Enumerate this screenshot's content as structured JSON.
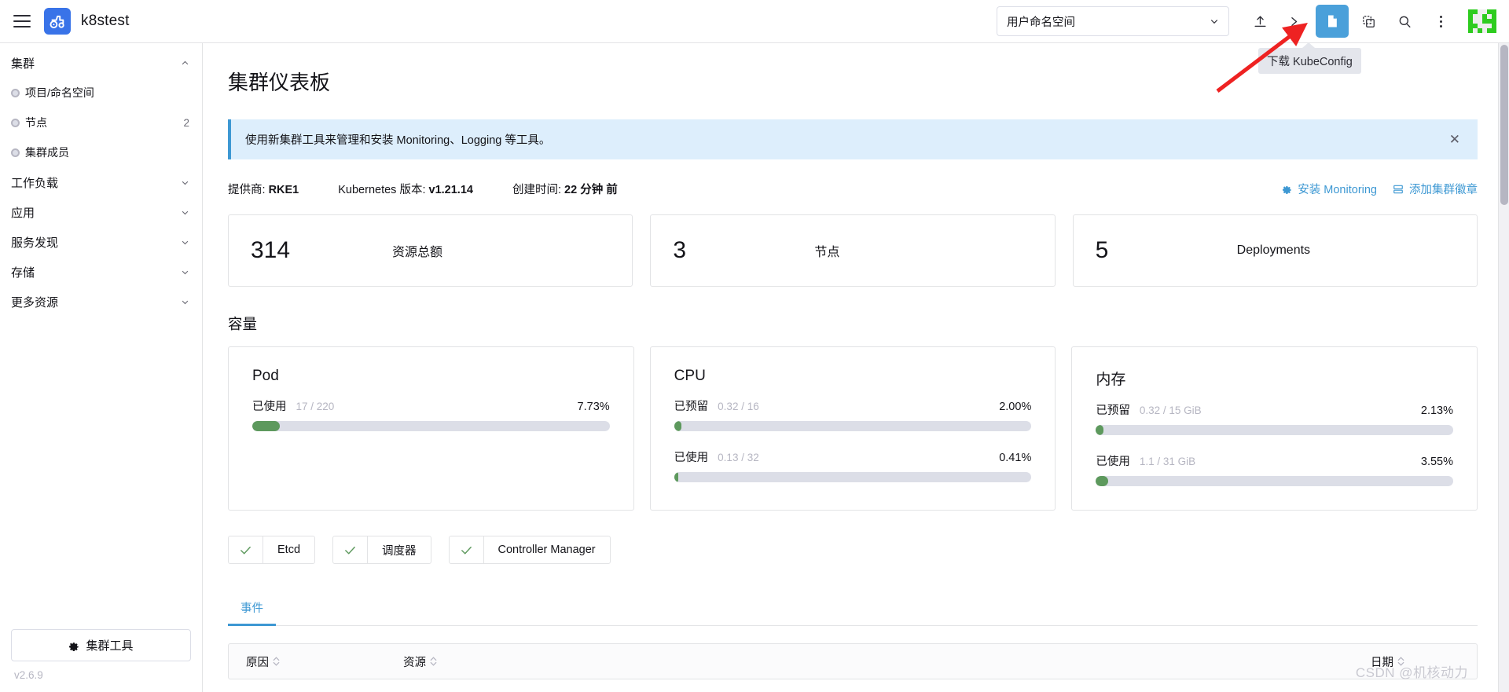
{
  "header": {
    "menu_icon": "hamburger-icon",
    "brand_name": "k8stest",
    "brand_logo_icon": "tractor-logo-icon",
    "namespace_select": {
      "value": "用户命名空间",
      "caret_icon": "chevron-down-icon"
    },
    "icons": [
      {
        "name": "import-yaml-icon",
        "glyph": "upload"
      },
      {
        "name": "kubectl-shell-icon",
        "glyph": "terminal"
      },
      {
        "name": "download-kubeconfig-icon",
        "glyph": "file",
        "active": true
      },
      {
        "name": "copy-kubeconfig-icon",
        "glyph": "copy"
      },
      {
        "name": "search-icon",
        "glyph": "search"
      },
      {
        "name": "more-actions-icon",
        "glyph": "kebab"
      }
    ],
    "tooltip": "下载 KubeConfig",
    "user_avatar_icon": "pixel-avatar-icon"
  },
  "sidebar": {
    "groups": [
      {
        "label": "集群",
        "expanded": true,
        "items": [
          {
            "label": "项目/命名空间",
            "count": ""
          },
          {
            "label": "节点",
            "count": "2"
          },
          {
            "label": "集群成员",
            "count": ""
          }
        ]
      },
      {
        "label": "工作负载",
        "expanded": false,
        "items": []
      },
      {
        "label": "应用",
        "expanded": false,
        "items": []
      },
      {
        "label": "服务发现",
        "expanded": false,
        "items": []
      },
      {
        "label": "存储",
        "expanded": false,
        "items": []
      },
      {
        "label": "更多资源",
        "expanded": false,
        "items": []
      }
    ],
    "cluster_tools_label": "集群工具",
    "version": "v2.6.9"
  },
  "main": {
    "title": "集群仪表板",
    "banner": {
      "text": "使用新集群工具来管理和安装 Monitoring、Logging 等工具。",
      "close_label": "✕"
    },
    "info": {
      "provider_label": "提供商:",
      "provider_value": "RKE1",
      "k8s_label": "Kubernetes 版本:",
      "k8s_value": "v1.21.14",
      "created_label": "创建时间:",
      "created_value": "22 分钟 前",
      "install_monitoring": "安装 Monitoring",
      "add_cluster_badge": "添加集群徽章"
    },
    "stats": [
      {
        "value": "314",
        "label": "资源总额"
      },
      {
        "value": "3",
        "label": "节点"
      },
      {
        "value": "5",
        "label": "Deployments"
      }
    ],
    "capacity_title": "容量",
    "capacity": [
      {
        "title": "Pod",
        "meters": [
          {
            "name": "已使用",
            "sub": "17 / 220",
            "pct_label": "7.73%",
            "pct": 7.73
          }
        ]
      },
      {
        "title": "CPU",
        "meters": [
          {
            "name": "已预留",
            "sub": "0.32 / 16",
            "pct_label": "2.00%",
            "pct": 2.0
          },
          {
            "name": "已使用",
            "sub": "0.13 / 32",
            "pct_label": "0.41%",
            "pct": 0.41
          }
        ]
      },
      {
        "title": "内存",
        "meters": [
          {
            "name": "已预留",
            "sub": "0.32 / 15 GiB",
            "pct_label": "2.13%",
            "pct": 2.13
          },
          {
            "name": "已使用",
            "sub": "1.1 / 31 GiB",
            "pct_label": "3.55%",
            "pct": 3.55
          }
        ]
      }
    ],
    "component_chips": [
      {
        "label": "Etcd",
        "status": "ok"
      },
      {
        "label": "调度器",
        "status": "ok"
      },
      {
        "label": "Controller Manager",
        "status": "ok"
      }
    ],
    "tabs": [
      {
        "label": "事件",
        "active": true
      }
    ],
    "table": {
      "columns": [
        {
          "key": "reason",
          "label": "原因"
        },
        {
          "key": "resource",
          "label": "资源"
        },
        {
          "key": "date",
          "label": "日期"
        }
      ],
      "rows": []
    }
  },
  "watermark": "CSDN @机核动力",
  "colors": {
    "accent_blue": "#3d98d3",
    "brand_blue": "#3973e8",
    "ok_green": "#5d995d",
    "banner_bg": "#ddeefc",
    "avatar_green": "#2ecc1f"
  }
}
